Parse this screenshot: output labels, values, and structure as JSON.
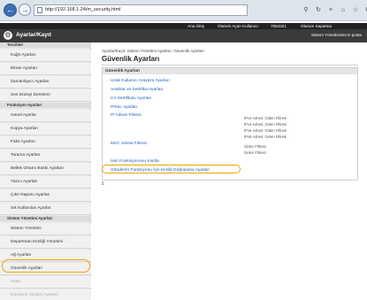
{
  "browser": {
    "back_icon": "arrow-left-icon",
    "forward_icon": "arrow-right-icon",
    "address": "http://192.168.1.24/m_security.html",
    "tab_text": "●●● Canon ●●●●●● ●●● ●●●",
    "toolbar_icons": [
      "search-icon",
      "refresh-icon",
      "close-icon",
      "home-icon",
      "star-icon",
      "gear-icon"
    ]
  },
  "topbar": {
    "ana_giris": "Ana Giriş",
    "oturum_acan": "Oturum Açan Kullanıcı:",
    "user": "7654321",
    "logout": "Oturum Kapatma"
  },
  "header": {
    "title": "Ayarlar/Kayıt",
    "right": "Sistem Yöneticisine E-posta"
  },
  "sidebar": {
    "sections": [
      {
        "label": "Tercihler"
      },
      {
        "label": "Fonksiyon Ayarları"
      },
      {
        "label": "Sistem Yönetimi Ayarları"
      }
    ],
    "items": [
      {
        "label": "Kağıt Ayarları"
      },
      {
        "label": "Ekran Ayarları"
      },
      {
        "label": "Zamanlayıcı Ayarları"
      },
      {
        "label": "Ses Düzeyi Denetimi"
      },
      {
        "label": "Genel Ayarlar"
      },
      {
        "label": "Kopya Ayarları"
      },
      {
        "label": "Faks Ayarları"
      },
      {
        "label": "Tarama Ayarları"
      },
      {
        "label": "Bellek Ortamı Baskı Ayarları"
      },
      {
        "label": "Yazıcı Ayarları"
      },
      {
        "label": "Çıktı Raporu Ayarları"
      },
      {
        "label": "Sık Kullanılan Ayarlar"
      },
      {
        "label": "Sistem Yönetimi"
      },
      {
        "label": "Departman Kimliği Yönetimi"
      },
      {
        "label": "Ağ Ayarları"
      },
      {
        "label": "Güvenlik Ayarları"
      },
      {
        "label": "Aktar"
      },
      {
        "label": "Donanım Yazılım Ayarları"
      }
    ]
  },
  "main": {
    "breadcrumb": "Ayarlar/Kayıt: Sistem Yönetimi Ayarları: Güvenlik Ayarları",
    "title": "Güvenlik Ayarları",
    "panel_title": "Güvenlik Ayarları",
    "links": {
      "uzak": "Uzak Kullanıcı Arayüzü Ayarları",
      "anahtar": "Anahtar ve Sertifika Ayarları",
      "ca": "CA Sertifikası Ayarları",
      "ipsec": "IPSec Ayarları",
      "ip_filter": "IP Adresi Filtresi",
      "mac_filter": "MAC Adresi Filtresi",
      "isim": "İsim Fonksiyonunu Kısıtla",
      "gonderim": "Gönderim Fonksiyonu İçin Kimlik Doğrulama Ayarları"
    },
    "ip_values": [
      "IPv4 Adresi: Giden Filtresi",
      "IPv4 Adresi: Gelen Filtresi",
      "IPv6 Adresi: Giden Filtresi",
      "IPv6 Adresi: Gelen Filtresi"
    ],
    "mac_values": [
      "Giden Filtresi",
      "Gelen Filtresi"
    ],
    "top_icon": "arrow-up-to-top-icon"
  }
}
